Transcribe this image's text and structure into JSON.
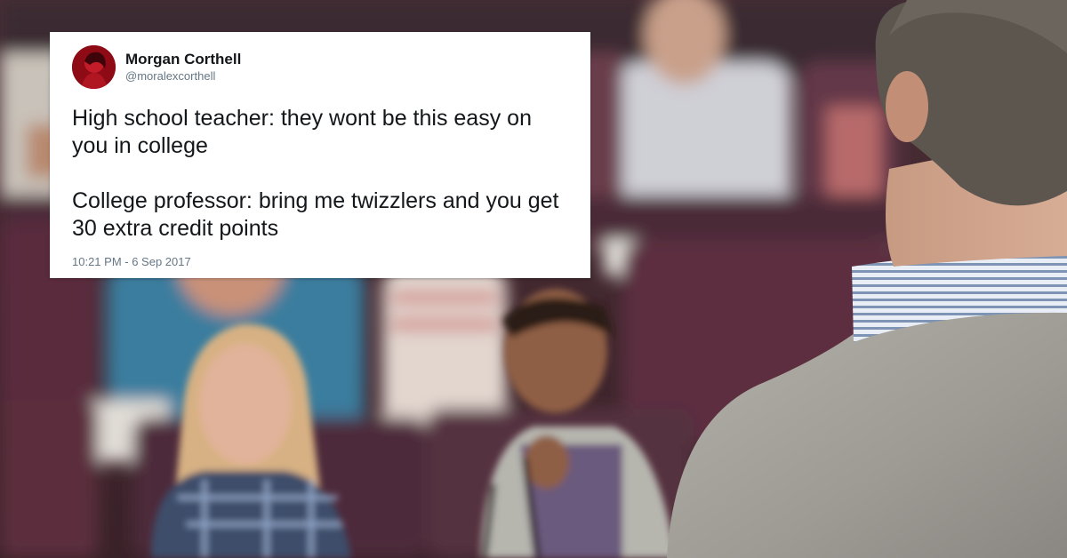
{
  "tweet": {
    "display_name": "Morgan Corthell",
    "handle": "@moralexcorthell",
    "text_paragraphs": [
      "High school teacher: they wont be this easy on you in college",
      "College professor: bring me twizzlers and you get 30 extra credit points"
    ],
    "timestamp": "10:21 PM - 6 Sep 2017"
  },
  "colors": {
    "card_background": "#ffffff",
    "name_text": "#14171a",
    "meta_text": "#657786",
    "seat_color": "#5a2f3c"
  },
  "scene": {
    "icons": [
      "avatar-photo",
      "lecture-hall-photo"
    ]
  }
}
